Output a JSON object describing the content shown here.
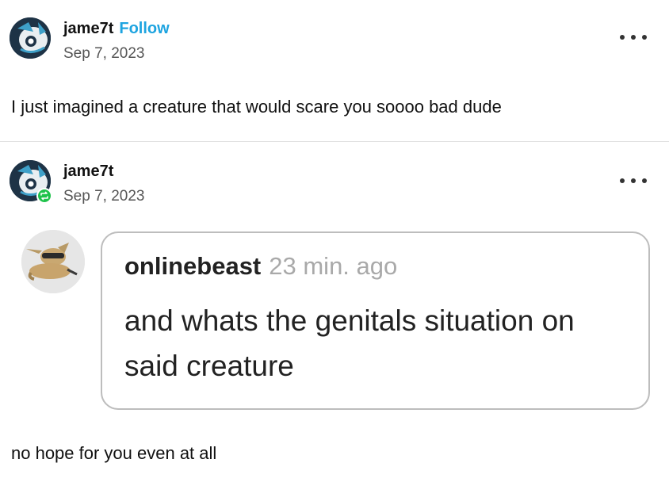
{
  "post": {
    "username": "jame7t",
    "follow_label": "Follow",
    "date": "Sep 7, 2023",
    "text": "I just imagined a creature that would scare you soooo bad dude"
  },
  "reblog": {
    "username": "jame7t",
    "date": "Sep 7, 2023",
    "ask": {
      "asker": "onlinebeast",
      "time": "23 min. ago",
      "question": "and whats the genitals situation on said creature"
    },
    "text": "no hope for you even at all"
  },
  "icons": {
    "more": "more-options-icon",
    "reblog": "reblog-icon"
  },
  "colors": {
    "follow": "#1ea4e0",
    "reblog_badge": "#1ec24a"
  }
}
